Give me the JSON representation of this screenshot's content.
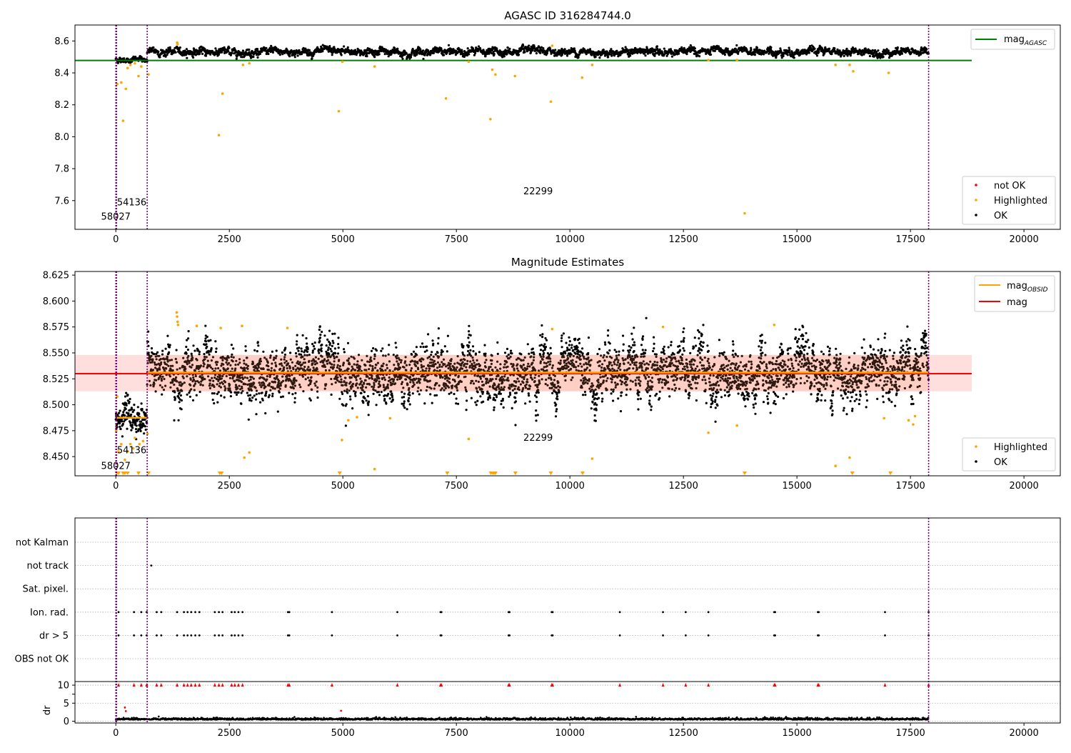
{
  "colors": {
    "ok": "#000000",
    "highlighted": "#ffa500",
    "not_ok": "#ff0000",
    "agasc_line": "#008000",
    "mag_line": "#ff0000",
    "obsid_line": "#ffa500",
    "band": "#ffb6b6",
    "obs_boundary": "#800080",
    "grid": "#b0b0b0"
  },
  "chart_data": [
    {
      "type": "scatter",
      "title": "AGASC ID 316284744.0",
      "xlim": [
        -900,
        20800
      ],
      "ylim": [
        7.42,
        8.7
      ],
      "xticks": [
        0,
        2500,
        5000,
        7500,
        10000,
        12500,
        15000,
        17500,
        20000
      ],
      "yticks": [
        7.6,
        7.8,
        8.0,
        8.2,
        8.4,
        8.6
      ],
      "ytick_labels": [
        "7.6",
        "7.8",
        "8.0",
        "8.2",
        "8.4",
        "8.6"
      ],
      "agasc_mag": 8.478,
      "agasc_span": [
        -900,
        18850
      ],
      "obs_boundaries": [
        0,
        15,
        690,
        17900
      ],
      "obs_labels": [
        {
          "text": "58027",
          "x": 0,
          "y": 7.48
        },
        {
          "text": "54136",
          "x": 350,
          "y": 7.57
        },
        {
          "text": "22299",
          "x": 9300,
          "y": 7.64
        }
      ],
      "segments": [
        {
          "x0": 0,
          "x1": 690,
          "mean": 8.483,
          "sd": 0.007
        },
        {
          "x0": 690,
          "x1": 17900,
          "mean": 8.532,
          "sd": 0.01
        }
      ],
      "highlighted_points": [
        [
          30,
          8.33
        ],
        [
          120,
          8.34
        ],
        [
          160,
          8.1
        ],
        [
          220,
          8.3
        ],
        [
          260,
          8.43
        ],
        [
          320,
          8.45
        ],
        [
          420,
          8.46
        ],
        [
          500,
          8.38
        ],
        [
          560,
          8.44
        ],
        [
          720,
          8.39
        ],
        [
          1350,
          8.59
        ],
        [
          1360,
          8.58
        ],
        [
          2270,
          8.01
        ],
        [
          2350,
          8.27
        ],
        [
          2800,
          8.45
        ],
        [
          2940,
          8.46
        ],
        [
          4910,
          8.16
        ],
        [
          4990,
          8.47
        ],
        [
          5700,
          8.44
        ],
        [
          7270,
          8.24
        ],
        [
          7770,
          8.47
        ],
        [
          8250,
          8.11
        ],
        [
          8290,
          8.42
        ],
        [
          8360,
          8.39
        ],
        [
          8790,
          8.38
        ],
        [
          9580,
          8.22
        ],
        [
          9610,
          8.57
        ],
        [
          10270,
          8.37
        ],
        [
          10490,
          8.45
        ],
        [
          13050,
          8.48
        ],
        [
          13680,
          8.48
        ],
        [
          13850,
          7.52
        ],
        [
          15850,
          8.45
        ],
        [
          16160,
          8.45
        ],
        [
          16240,
          8.41
        ],
        [
          17020,
          8.4
        ]
      ],
      "legend_lines": [
        {
          "label": "mag",
          "sub": "AGASC"
        }
      ],
      "legend_points": [
        {
          "label": "not OK",
          "color_key": "not_ok"
        },
        {
          "label": "Highlighted",
          "color_key": "highlighted"
        },
        {
          "label": "OK",
          "color_key": "ok"
        }
      ]
    },
    {
      "type": "scatter",
      "title": "Magnitude Estimates",
      "xlim": [
        -900,
        20800
      ],
      "ylim": [
        8.4315,
        8.6285
      ],
      "xticks": [
        0,
        2500,
        5000,
        7500,
        10000,
        12500,
        15000,
        17500,
        20000
      ],
      "yticks": [
        8.45,
        8.475,
        8.5,
        8.525,
        8.55,
        8.575,
        8.6,
        8.625
      ],
      "ytick_labels": [
        "8.450",
        "8.475",
        "8.500",
        "8.525",
        "8.550",
        "8.575",
        "8.600",
        "8.625"
      ],
      "mag": 8.53,
      "mag_band": [
        8.513,
        8.548
      ],
      "mag_span": [
        -900,
        18850
      ],
      "obsid_mags": [
        {
          "x0": 0,
          "x1": 690,
          "mag": 8.4875
        },
        {
          "x0": 690,
          "x1": 17900,
          "mag": 8.531
        }
      ],
      "obs_boundaries": [
        0,
        15,
        690,
        17900
      ],
      "obs_labels": [
        {
          "text": "58027",
          "x": 0,
          "y": 8.4382
        },
        {
          "text": "54136",
          "x": 350,
          "y": 8.4532
        },
        {
          "text": "22299",
          "x": 9300,
          "y": 8.4652
        }
      ],
      "segments": [
        {
          "x0": 0,
          "x1": 690,
          "mean": 8.487,
          "sd": 0.006
        },
        {
          "x0": 690,
          "x1": 17900,
          "mean": 8.531,
          "sd": 0.011
        }
      ],
      "highlighted_points": [
        [
          10,
          8.475
        ],
        [
          30,
          8.508
        ],
        [
          60,
          8.455
        ],
        [
          120,
          8.462
        ],
        [
          200,
          8.447
        ],
        [
          260,
          8.455
        ],
        [
          320,
          8.462
        ],
        [
          380,
          8.458
        ],
        [
          420,
          8.468
        ],
        [
          520,
          8.462
        ],
        [
          600,
          8.465
        ],
        [
          700,
          8.472
        ],
        [
          1340,
          8.589
        ],
        [
          1350,
          8.585
        ],
        [
          1360,
          8.58
        ],
        [
          1370,
          8.577
        ],
        [
          1780,
          8.576
        ],
        [
          2310,
          8.574
        ],
        [
          2780,
          8.576
        ],
        [
          2830,
          8.449
        ],
        [
          2940,
          8.454
        ],
        [
          3780,
          8.574
        ],
        [
          4980,
          8.466
        ],
        [
          5120,
          8.485
        ],
        [
          5310,
          8.488
        ],
        [
          5700,
          8.438
        ],
        [
          6040,
          8.487
        ],
        [
          7770,
          8.467
        ],
        [
          9610,
          8.573
        ],
        [
          10490,
          8.448
        ],
        [
          12050,
          8.575
        ],
        [
          13050,
          8.473
        ],
        [
          13680,
          8.48
        ],
        [
          14500,
          8.577
        ],
        [
          15850,
          8.441
        ],
        [
          16160,
          8.449
        ],
        [
          16920,
          8.487
        ],
        [
          17460,
          8.485
        ],
        [
          17560,
          8.481
        ],
        [
          17600,
          8.489
        ]
      ],
      "clipped_points_x": [
        20,
        60,
        160,
        200,
        260,
        500,
        720,
        2290,
        2330,
        4930,
        7300,
        8260,
        8300,
        8330,
        8360,
        8800,
        9580,
        10280,
        13850,
        16220,
        17060
      ],
      "legend_lines": [
        {
          "label": "mag",
          "sub": "OBSID",
          "color_key": "obsid_line"
        },
        {
          "label": "mag",
          "sub": "",
          "color_key": "mag_line"
        }
      ],
      "legend_points": [
        {
          "label": "Highlighted",
          "color_key": "highlighted"
        },
        {
          "label": "OK",
          "color_key": "ok"
        }
      ]
    },
    {
      "type": "scatter",
      "title": "",
      "xlim": [
        -900,
        20800
      ],
      "xticks": [
        0,
        2500,
        5000,
        7500,
        10000,
        12500,
        15000,
        17500,
        20000
      ],
      "flag_rows": [
        "not Kalman",
        "not track",
        "Sat. pixel.",
        "Ion. rad.",
        "dr > 5",
        "OBS not OK"
      ],
      "obs_boundaries": [
        0,
        15,
        690,
        17900
      ],
      "flag_points": {
        "not track": [
          780
        ],
        "Ion. rad.": [
          60,
          400,
          560,
          680,
          900,
          1000,
          1350,
          1500,
          1580,
          1660,
          1750,
          1840,
          2180,
          2270,
          2350,
          2550,
          2620,
          2700,
          2790,
          3790,
          3820,
          4760,
          6200,
          7150,
          7170,
          8650,
          8670,
          9600,
          9620,
          11100,
          12050,
          12550,
          13050,
          14500,
          14520,
          15460,
          15480,
          16940,
          17900
        ],
        "dr > 5": [
          60,
          400,
          560,
          680,
          900,
          1000,
          1350,
          1500,
          1580,
          1660,
          1750,
          1840,
          2180,
          2270,
          2350,
          2550,
          2620,
          2700,
          2790,
          3790,
          3820,
          4760,
          6200,
          7150,
          7170,
          8650,
          8670,
          9600,
          9620,
          11100,
          12050,
          12550,
          13050,
          14500,
          14520,
          15460,
          15480,
          16940,
          17900
        ]
      },
      "dr": {
        "ylabel": "dr",
        "yticks": [
          0,
          5,
          10
        ],
        "ylim": [
          -0.5,
          11
        ],
        "baseline_mean": 0.4,
        "baseline_sd": 0.25,
        "red_outliers": [
          [
            200,
            3.8
          ],
          [
            220,
            2.8
          ],
          [
            4960,
            2.9
          ]
        ],
        "flag_x": [
          60,
          400,
          560,
          680,
          900,
          1000,
          1350,
          1500,
          1580,
          1660,
          1750,
          1840,
          2180,
          2270,
          2350,
          2550,
          2620,
          2700,
          2790,
          3790,
          3820,
          4760,
          6200,
          7150,
          7170,
          8650,
          8670,
          9600,
          9620,
          11100,
          12050,
          12550,
          13050,
          14500,
          14520,
          15460,
          15480,
          16940,
          17900
        ]
      }
    }
  ]
}
